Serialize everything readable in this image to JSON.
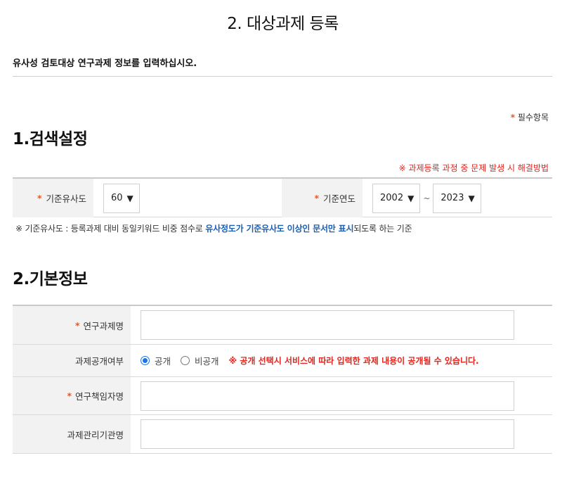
{
  "page": {
    "title": "2. 대상과제 등록",
    "intro": "유사성 검토대상 연구과제 정보를 입력하십시오.",
    "required_star": "*",
    "required_legend": "필수항목"
  },
  "search": {
    "section_title": "1.검색설정",
    "help_link": "※ 과제등록 과정 중 문제 발생 시 해결방법",
    "similarity_label": "기준유사도",
    "similarity_value": "60",
    "year_label": "기준연도",
    "year_from": "2002",
    "year_sep": "~",
    "year_to": "2023",
    "arrow": "▼",
    "note_prefix": "※ 기준유사도 : 등록과제 대비 동일키워드 비중 점수로 ",
    "note_highlight": "유사정도가 기준유사도 이상인 문서만 표시",
    "note_suffix": "되도록 하는 기준"
  },
  "basic": {
    "section_title": "2.기본정보",
    "project_name_label": "연구과제명",
    "public_label": "과제공개여부",
    "public_option": "공개",
    "private_option": "비공개",
    "public_selected": "공개",
    "public_warning": "※ 공개 선택시 서비스에 따라 입력한 과제 내용이 공개될 수 있습니다.",
    "researcher_label": "연구책임자명",
    "agency_label": "과제관리기관명"
  },
  "colors": {
    "required_star": "#e05a2b",
    "warning_red": "#e0261f",
    "highlight_blue": "#1b5fb3",
    "header_bg": "#f2f2f2"
  }
}
